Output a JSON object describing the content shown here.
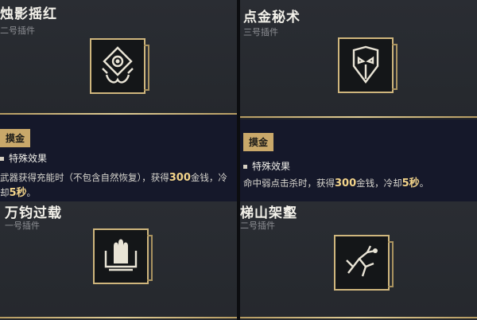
{
  "cards": [
    {
      "title": "烛影摇红",
      "subtitle": "二号插件",
      "icon": "flame-eye-emblem-icon",
      "tag": "摸金",
      "effect_header": "特殊效果",
      "description_parts": [
        "武器获得充能时（不包含自然恢复），获得",
        "300",
        "金钱，冷却",
        "5秒",
        "。"
      ]
    },
    {
      "title": "点金秘术",
      "subtitle": "三号插件",
      "icon": "mask-emblem-icon",
      "tag": "摸金",
      "effect_header": "特殊效果",
      "description_parts": [
        "命中弱点击杀时，获得",
        "300",
        "金钱，冷却",
        "5秒",
        "。"
      ]
    },
    {
      "title": "万钧过载",
      "subtitle": "一号插件",
      "icon": "bullets-emblem-icon"
    },
    {
      "title": "梯山架壑",
      "subtitle": "二号插件",
      "icon": "climbing-beast-emblem-icon"
    }
  ],
  "colors": {
    "gold": "#cfb67d",
    "highlight": "#f3d48a",
    "panel_dark": "#15182a"
  }
}
